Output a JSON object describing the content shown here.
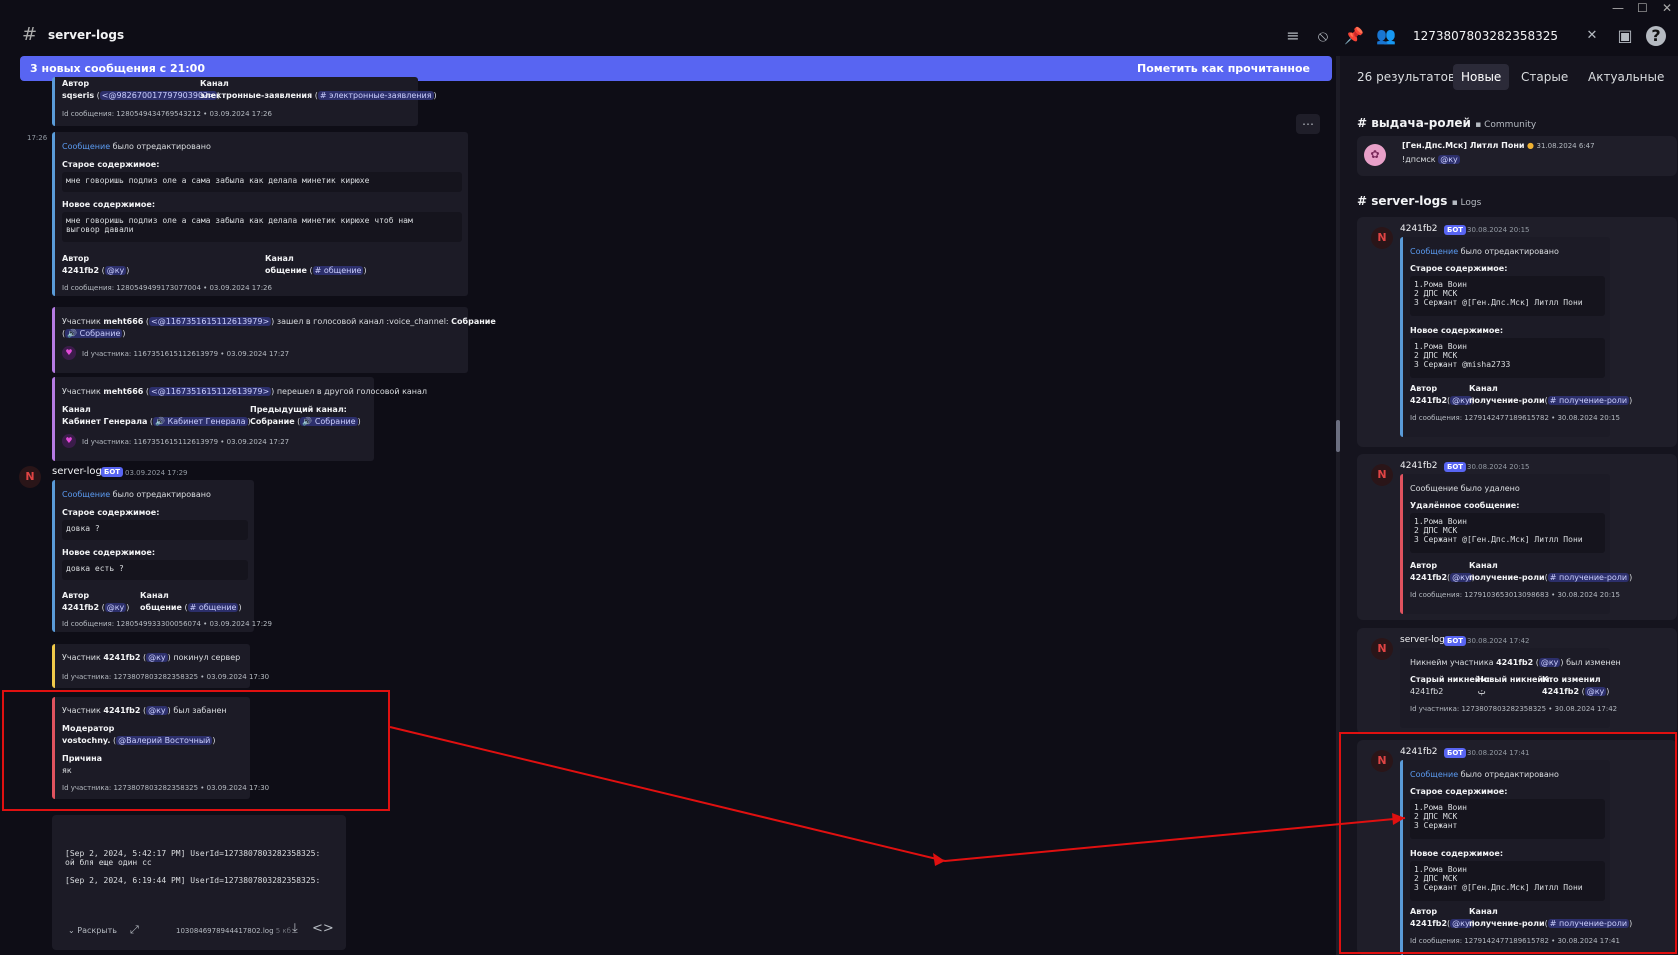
{
  "window": {
    "minimize": "—",
    "maximize": "☐",
    "close": "✕"
  },
  "header": {
    "channel": "server-logs",
    "search_query": "1273807803282358325",
    "clear": "✕"
  },
  "banner": {
    "text": "3 новых сообщения с 21:00",
    "mark_read": "Пометить как прочитанное"
  },
  "main": {
    "m0": {
      "author_lbl": "Автор",
      "channel_lbl": "Канал",
      "author": "sqseris",
      "author_ment": "<@982670017797903902>",
      "channel": "электронные-заявления",
      "channel_ment": "# электронные-заявления",
      "id": "Id сообщения: 1280549434769543212 • 03.09.2024 17:26"
    },
    "time1": "17:26",
    "m1": {
      "edited_link": "Сообщение",
      "edited_rest": " было отредактировано",
      "old_lbl": "Старое содержимое:",
      "old": "мне говоришь подлиз оле а сама забыла как делала минетик кирюхе",
      "new_lbl": "Новое содержимое:",
      "new": "мне говоришь подлиз оле а сама забыла как делала минетик кирюхе чтоб нам\nвыговор давали",
      "author_lbl": "Автор",
      "channel_lbl": "Канал",
      "author": "4241fb2",
      "author_ment": "@ку",
      "channel": "общение",
      "channel_ment": "# общение",
      "id": "Id сообщения: 1280549499173077004 • 03.09.2024 17:26"
    },
    "m2": {
      "p1": "Участник ",
      "user": "meht666",
      "ment": "<@1167351615112613979>",
      "p2": " зашел в голосовой канал :voice_channel: ",
      "ch": "Собрание",
      "ch_ment": "🔊 Собрание",
      "id": "Id участника: 1167351615112613979 • 03.09.2024 17:27"
    },
    "m3": {
      "p1": "Участник ",
      "user": "meht666",
      "ment": "<@1167351615112613979>",
      "p2": " перешел в другой голосовой канал",
      "ch_lbl": "Канал",
      "prev_lbl": "Предыдущий канал:",
      "ch": "Кабинет Генерала",
      "ch_ment": "🔊 Кабинет Генерала",
      "prev": "Собрание",
      "prev_ment": "🔊 Собрание",
      "id": "Id участника: 1167351615112613979 • 03.09.2024 17:27"
    },
    "msg": {
      "author": "server-logs",
      "bot": "БОТ",
      "ts": "03.09.2024 17:29"
    },
    "m4": {
      "edited_link": "Сообщение",
      "edited_rest": " было отредактировано",
      "old_lbl": "Старое содержимое:",
      "old": "довка ?",
      "new_lbl": "Новое содержимое:",
      "new": "довка есть ?",
      "author_lbl": "Автор",
      "channel_lbl": "Канал",
      "author": "4241fb2",
      "author_ment": "@ку",
      "channel": "общение",
      "channel_ment": "# общение",
      "id": "Id сообщения: 1280549933300056074 • 03.09.2024 17:29"
    },
    "m5": {
      "p1": "Участник ",
      "user": "4241fb2",
      "ment": "@ку",
      "p2": " покинул сервер",
      "id": "Id участника: 1273807803282358325 • 03.09.2024 17:30"
    },
    "m6": {
      "p1": "Участник ",
      "user": "4241fb2",
      "ment": "@ку",
      "p2": " был забанен",
      "mod_lbl": "Модератор",
      "mod": "vostochny.",
      "mod_ment": "@Валерий Восточный",
      "reason_lbl": "Причина",
      "reason": "як",
      "id": "Id участника: 1273807803282358325 • 03.09.2024 17:30"
    },
    "file": {
      "text": "[Sep 2, 2024, 5:42:17 PM] UserId=1273807803282358325:\nой бля еще один сс\n\n[Sep 2, 2024, 6:19:44 PM] UserId=1273807803282358325:",
      "expand": "Раскрыть",
      "name": "1030846978944417802.log",
      "size": "5 кб"
    }
  },
  "results": {
    "count": "26 результатов",
    "tabs": [
      "Новые",
      "Старые",
      "Актуальные"
    ],
    "g1": {
      "channel": "выдача-ролей",
      "category": "Community",
      "author": "[Ген.Дпс.Мск] Литлл Пони",
      "ts": "31.08.2024 6:47",
      "content": "!дпсмск",
      "ment": "@ку"
    },
    "g2": {
      "channel": "server-logs",
      "category": "Logs"
    },
    "r1": {
      "author": "4241fb2",
      "bot": "БОТ",
      "ts": "30.08.2024 20:15",
      "edited_link": "Сообщение",
      "edited_rest": " было отредактировано",
      "old_lbl": "Старое содержимое:",
      "old": "1.Рома Воин\n2 ДПС МСК\n3 Сержант @[Ген.Дпс.Мск] Литлл Пони",
      "new_lbl": "Новое содержимое:",
      "new": "1.Рома Воин\n2 ДПС МСК\n3 Сержант @misha2733",
      "author_lbl": "Автор",
      "channel_lbl": "Канал",
      "author_ment": "@ку",
      "channel": "получение-роли",
      "channel_ment": "# получение-роли",
      "id": "Id сообщения: 1279142477189615782 • 30.08.2024 20:15"
    },
    "r2": {
      "author": "4241fb2",
      "bot": "БОТ",
      "ts": "30.08.2024 20:15",
      "deleted": "Сообщение было удалено",
      "del_lbl": "Удалённое сообщение:",
      "del": "1.Рома Воин\n2 ДПС МСК\n3 Сержант @[Ген.Дпс.Мск] Литлл Пони",
      "author_lbl": "Автор",
      "channel_lbl": "Канал",
      "author_ment": "@ку",
      "channel": "получение-роли",
      "channel_ment": "# получение-роли",
      "id": "Id сообщения: 1279103653013098683 • 30.08.2024 20:15"
    },
    "r3": {
      "author": "server-logs",
      "bot": "БОТ",
      "ts": "30.08.2024 17:42",
      "p1": "Никнейм участника ",
      "user": "4241fb2",
      "ment": "@ку",
      "p2": " был изменен",
      "old_lbl": "Старый никнейм:",
      "new_lbl": "Новый никнейм:",
      "who_lbl": "Кто изменил",
      "old": "4241fb2",
      "new": "ࢶ",
      "who": "4241fb2",
      "who_ment": "@ку",
      "id": "Id участника: 1273807803282358325 • 30.08.2024 17:42"
    },
    "r4": {
      "author": "4241fb2",
      "bot": "БОТ",
      "ts": "30.08.2024 17:41",
      "edited_link": "Сообщение",
      "edited_rest": " было отредактировано",
      "old_lbl": "Старое содержимое:",
      "old": "1.Рома Воин\n2 ДПС МСК\n3 Сержант",
      "new_lbl": "Новое содержимое:",
      "new": "1.Рома Воин\n2 ДПС МСК\n3 Сержант @[Ген.Дпс.Мск] Литлл Пони",
      "author_lbl": "Автор",
      "channel_lbl": "Канал",
      "author_ment": "@ку",
      "channel": "получение-роли",
      "channel_ment": "# получение-роли",
      "id": "Id сообщения: 1279142477189615782 • 30.08.2024 17:41"
    }
  },
  "colors": {
    "accent": "#5865f2",
    "annotation": "#e01010"
  }
}
